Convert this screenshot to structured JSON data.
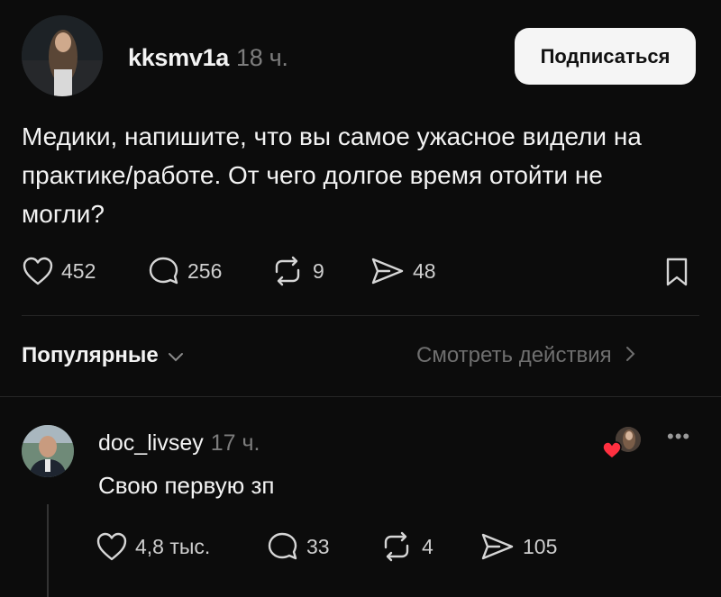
{
  "post": {
    "author": "kksmv1a",
    "time": "18 ч.",
    "follow_label": "Подписаться",
    "text": "Медики, напишите, что вы самое ужасное видели на практике/работе. От чего долгое время отойти не могли?",
    "likes": "452",
    "comments": "256",
    "reposts": "9",
    "shares": "48",
    "icons": [
      "heart-icon",
      "comment-icon",
      "repost-icon",
      "share-icon",
      "bookmark-icon"
    ]
  },
  "replies_bar": {
    "sort_label": "Популярные",
    "view_activity_label": "Смотреть действия"
  },
  "comment": {
    "author": "doc_livsey",
    "time": "17 ч.",
    "text": "Свою первую зп",
    "likes": "4,8 тыс.",
    "comments": "33",
    "reposts": "4",
    "shares": "105",
    "more_label": "•••"
  },
  "colors": {
    "background": "#0c0c0c",
    "text": "#f3f3f3",
    "muted": "#7d7d7d",
    "button_bg": "#f5f5f5",
    "like_heart": "#ff3040"
  }
}
